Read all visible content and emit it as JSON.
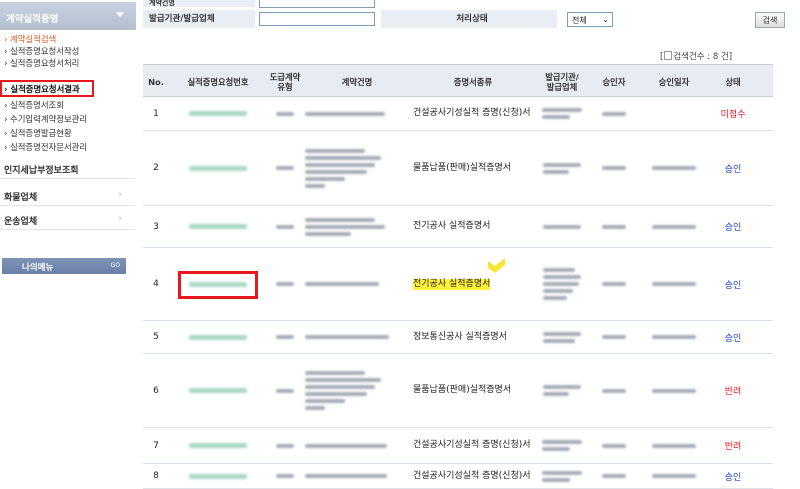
{
  "sidebar": {
    "header": "계약실적증명",
    "items": [
      {
        "label": "› 계약실적검색",
        "state": "active"
      },
      {
        "label": "› 실적증명요청서작성",
        "state": ""
      },
      {
        "label": "› 실적증명요청서처리",
        "state": ""
      },
      {
        "label": "› 실적증명요청서결과",
        "state": "selected"
      },
      {
        "label": "› 실적증명서조회",
        "state": ""
      },
      {
        "label": "› 수기입력계약정보관리",
        "state": ""
      },
      {
        "label": "› 실적증명발급현황",
        "state": ""
      },
      {
        "label": "› 실적증명전자문서관리",
        "state": ""
      }
    ],
    "sections": [
      "인지세납부정보조회",
      "화물업체",
      "운송업체"
    ],
    "my_menu": {
      "label": "나의메뉴",
      "go": "GO"
    }
  },
  "search": {
    "contract_label": "계약건명",
    "issuer_label": "발급기관/발급업체",
    "issuer_value": "",
    "status_label": "처리상태",
    "status_selected": "전체",
    "search_button": "검색"
  },
  "result_count": "검색건수 : 8 건]",
  "result_bracket": "[",
  "table": {
    "headers": [
      "No.",
      "실적증명요청번호",
      "도급계약\n유형",
      "계약건명",
      "증명서종류",
      "발급기관/\n발급업체",
      "승인자",
      "승인일자",
      "상태"
    ],
    "rows": [
      {
        "no": "1",
        "type": "건설공사기성실적 증명(신청)서",
        "status": "미접수",
        "status_color": "red"
      },
      {
        "no": "2",
        "type": "물품납품(판매)실적증명서",
        "status": "승인",
        "status_color": "blue"
      },
      {
        "no": "3",
        "type": "전기공사 실적증명서",
        "status": "승인",
        "status_color": "blue"
      },
      {
        "no": "4",
        "type": "전기공사 실적증명서",
        "status": "승인",
        "status_color": "blue"
      },
      {
        "no": "5",
        "type": "정보통신공사 실적증명서",
        "status": "승인",
        "status_color": "blue"
      },
      {
        "no": "6",
        "type": "물품납품(판매)실적증명서",
        "status": "반려",
        "status_color": "red"
      },
      {
        "no": "7",
        "type": "건설공사기성실적 증명(신청)서",
        "status": "반려",
        "status_color": "red"
      },
      {
        "no": "8",
        "type": "건설공사기성실적 증명(신청)서",
        "status": "승인",
        "status_color": "blue"
      }
    ]
  },
  "colors": {
    "accent_red": "#e8161d",
    "approved_blue": "#1b3ecb",
    "highlight": "#fff23a"
  }
}
